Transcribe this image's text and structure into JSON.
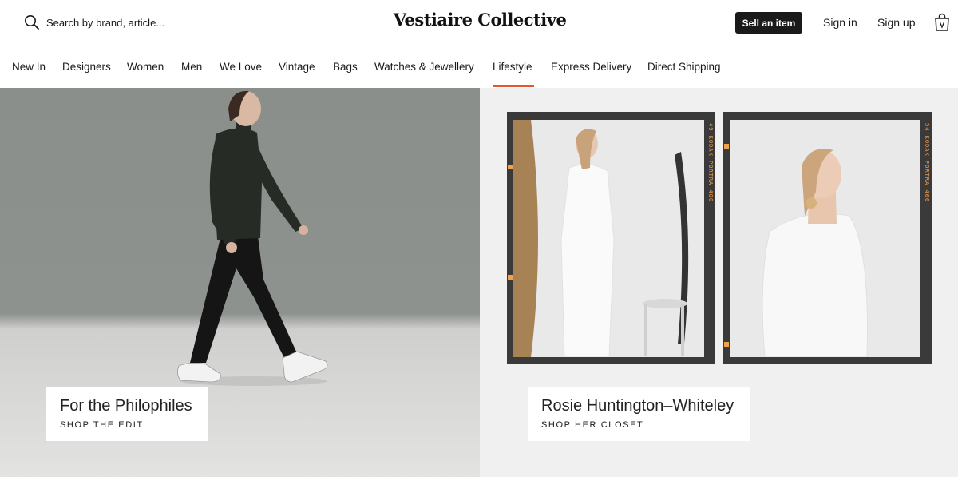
{
  "header": {
    "search_placeholder": "Search by brand, article...",
    "logo": "Vestiaire Collective",
    "sell_label": "Sell an item",
    "signin_label": "Sign in",
    "signup_label": "Sign up"
  },
  "nav": {
    "items": [
      "New In",
      "Designers",
      "Women",
      "Men",
      "We Love",
      "Vintage",
      "Bags",
      "Watches & Jewellery",
      "Lifestyle",
      "Express Delivery",
      "Direct Shipping"
    ],
    "active": "Lifestyle"
  },
  "colors": {
    "accent": "#e2572b",
    "sell_button": "#1a1a1a"
  },
  "hero": {
    "left": {
      "title": "For the Philophiles",
      "link": "SHOP THE EDIT"
    },
    "right": {
      "title": "Rosie Huntington–Whiteley",
      "link": "SHOP HER CLOSET",
      "film_edge_left": "49  KODAK PORTRA 400",
      "film_edge_right": "54  KODAK PORTRA 400"
    }
  },
  "icons": [
    "search-icon",
    "shopping-bag-icon"
  ]
}
